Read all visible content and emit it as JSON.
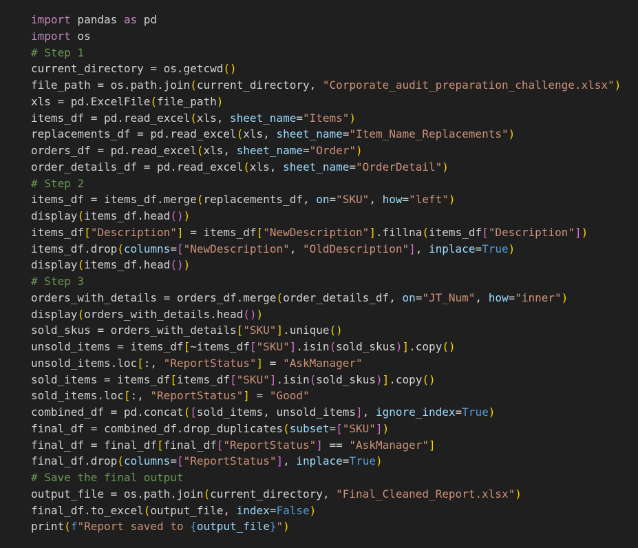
{
  "colors": {
    "background": "#1f1f1f",
    "default_text": "#d4d4d4",
    "keyword": "#c586c0",
    "comment": "#6a9955",
    "string": "#ce9178",
    "param": "#9cdcfe",
    "constant": "#569cd6",
    "bracket_level_1": "#ffd700",
    "bracket_level_2": "#da70d6",
    "bracket_level_3": "#179fff"
  },
  "code": {
    "language": "python",
    "lines": [
      [
        [
          "keyword",
          "import"
        ],
        [
          "name",
          " pandas "
        ],
        [
          "keyword",
          "as"
        ],
        [
          "name",
          " pd"
        ]
      ],
      [
        [
          "keyword",
          "import"
        ],
        [
          "name",
          " os"
        ]
      ],
      [
        [
          "comment",
          "# Step 1"
        ]
      ],
      [
        [
          "name",
          "current_directory = os.getcwd"
        ],
        [
          "paren1",
          "()"
        ]
      ],
      [
        [
          "name",
          "file_path = os.path.join"
        ],
        [
          "paren1",
          "("
        ],
        [
          "name",
          "current_directory, "
        ],
        [
          "string",
          "\"Corporate_audit_preparation_challenge.xlsx\""
        ],
        [
          "paren1",
          ")"
        ]
      ],
      [
        [
          "name",
          "xls = pd.ExcelFile"
        ],
        [
          "paren1",
          "("
        ],
        [
          "name",
          "file_path"
        ],
        [
          "paren1",
          ")"
        ]
      ],
      [
        [
          "name",
          "items_df = pd.read_excel"
        ],
        [
          "paren1",
          "("
        ],
        [
          "name",
          "xls, "
        ],
        [
          "param",
          "sheet_name"
        ],
        [
          "name",
          "="
        ],
        [
          "string",
          "\"Items\""
        ],
        [
          "paren1",
          ")"
        ]
      ],
      [
        [
          "name",
          "replacements_df = pd.read_excel"
        ],
        [
          "paren1",
          "("
        ],
        [
          "name",
          "xls, "
        ],
        [
          "param",
          "sheet_name"
        ],
        [
          "name",
          "="
        ],
        [
          "string",
          "\"Item_Name_Replacements\""
        ],
        [
          "paren1",
          ")"
        ]
      ],
      [
        [
          "name",
          "orders_df = pd.read_excel"
        ],
        [
          "paren1",
          "("
        ],
        [
          "name",
          "xls, "
        ],
        [
          "param",
          "sheet_name"
        ],
        [
          "name",
          "="
        ],
        [
          "string",
          "\"Order\""
        ],
        [
          "paren1",
          ")"
        ]
      ],
      [
        [
          "name",
          "order_details_df = pd.read_excel"
        ],
        [
          "paren1",
          "("
        ],
        [
          "name",
          "xls, "
        ],
        [
          "param",
          "sheet_name"
        ],
        [
          "name",
          "="
        ],
        [
          "string",
          "\"OrderDetail\""
        ],
        [
          "paren1",
          ")"
        ]
      ],
      [
        [
          "comment",
          "# Step 2"
        ]
      ],
      [
        [
          "name",
          "items_df = items_df.merge"
        ],
        [
          "paren1",
          "("
        ],
        [
          "name",
          "replacements_df, "
        ],
        [
          "param",
          "on"
        ],
        [
          "name",
          "="
        ],
        [
          "string",
          "\"SKU\""
        ],
        [
          "name",
          ", "
        ],
        [
          "param",
          "how"
        ],
        [
          "name",
          "="
        ],
        [
          "string",
          "\"left\""
        ],
        [
          "paren1",
          ")"
        ]
      ],
      [
        [
          "name",
          "display"
        ],
        [
          "paren1",
          "("
        ],
        [
          "name",
          "items_df.head"
        ],
        [
          "paren2",
          "()"
        ],
        [
          "paren1",
          ")"
        ]
      ],
      [
        [
          "name",
          "items_df"
        ],
        [
          "paren1",
          "["
        ],
        [
          "string",
          "\"Description\""
        ],
        [
          "paren1",
          "]"
        ],
        [
          "name",
          " = items_df"
        ],
        [
          "paren1",
          "["
        ],
        [
          "string",
          "\"NewDescription\""
        ],
        [
          "paren1",
          "]"
        ],
        [
          "name",
          ".fillna"
        ],
        [
          "paren1",
          "("
        ],
        [
          "name",
          "items_df"
        ],
        [
          "paren2",
          "["
        ],
        [
          "string",
          "\"Description\""
        ],
        [
          "paren2",
          "]"
        ],
        [
          "paren1",
          ")"
        ]
      ],
      [
        [
          "name",
          "items_df.drop"
        ],
        [
          "paren1",
          "("
        ],
        [
          "param",
          "columns"
        ],
        [
          "name",
          "="
        ],
        [
          "paren2",
          "["
        ],
        [
          "string",
          "\"NewDescription\""
        ],
        [
          "name",
          ", "
        ],
        [
          "string",
          "\"OldDescription\""
        ],
        [
          "paren2",
          "]"
        ],
        [
          "name",
          ", "
        ],
        [
          "param",
          "inplace"
        ],
        [
          "name",
          "="
        ],
        [
          "const",
          "True"
        ],
        [
          "paren1",
          ")"
        ]
      ],
      [
        [
          "name",
          "display"
        ],
        [
          "paren1",
          "("
        ],
        [
          "name",
          "items_df.head"
        ],
        [
          "paren2",
          "()"
        ],
        [
          "paren1",
          ")"
        ]
      ],
      [
        [
          "comment",
          "# Step 3"
        ]
      ],
      [
        [
          "name",
          "orders_with_details = orders_df.merge"
        ],
        [
          "paren1",
          "("
        ],
        [
          "name",
          "order_details_df, "
        ],
        [
          "param",
          "on"
        ],
        [
          "name",
          "="
        ],
        [
          "string",
          "\"JT_Num\""
        ],
        [
          "name",
          ", "
        ],
        [
          "param",
          "how"
        ],
        [
          "name",
          "="
        ],
        [
          "string",
          "\"inner\""
        ],
        [
          "paren1",
          ")"
        ]
      ],
      [
        [
          "name",
          "display"
        ],
        [
          "paren1",
          "("
        ],
        [
          "name",
          "orders_with_details.head"
        ],
        [
          "paren2",
          "()"
        ],
        [
          "paren1",
          ")"
        ]
      ],
      [
        [
          "name",
          "sold_skus = orders_with_details"
        ],
        [
          "paren1",
          "["
        ],
        [
          "string",
          "\"SKU\""
        ],
        [
          "paren1",
          "]"
        ],
        [
          "name",
          ".unique"
        ],
        [
          "paren1",
          "()"
        ]
      ],
      [
        [
          "name",
          "unsold_items = items_df"
        ],
        [
          "paren1",
          "["
        ],
        [
          "name",
          "~items_df"
        ],
        [
          "paren2",
          "["
        ],
        [
          "string",
          "\"SKU\""
        ],
        [
          "paren2",
          "]"
        ],
        [
          "name",
          ".isin"
        ],
        [
          "paren2",
          "("
        ],
        [
          "name",
          "sold_skus"
        ],
        [
          "paren2",
          ")"
        ],
        [
          "paren1",
          "]"
        ],
        [
          "name",
          ".copy"
        ],
        [
          "paren1",
          "()"
        ]
      ],
      [
        [
          "name",
          "unsold_items.loc"
        ],
        [
          "paren1",
          "["
        ],
        [
          "name",
          ":, "
        ],
        [
          "string",
          "\"ReportStatus\""
        ],
        [
          "paren1",
          "]"
        ],
        [
          "name",
          " = "
        ],
        [
          "string",
          "\"AskManager\""
        ]
      ],
      [
        [
          "name",
          "sold_items = items_df"
        ],
        [
          "paren1",
          "["
        ],
        [
          "name",
          "items_df"
        ],
        [
          "paren2",
          "["
        ],
        [
          "string",
          "\"SKU\""
        ],
        [
          "paren2",
          "]"
        ],
        [
          "name",
          ".isin"
        ],
        [
          "paren2",
          "("
        ],
        [
          "name",
          "sold_skus"
        ],
        [
          "paren2",
          ")"
        ],
        [
          "paren1",
          "]"
        ],
        [
          "name",
          ".copy"
        ],
        [
          "paren1",
          "()"
        ]
      ],
      [
        [
          "name",
          "sold_items.loc"
        ],
        [
          "paren1",
          "["
        ],
        [
          "name",
          ":, "
        ],
        [
          "string",
          "\"ReportStatus\""
        ],
        [
          "paren1",
          "]"
        ],
        [
          "name",
          " = "
        ],
        [
          "string",
          "\"Good\""
        ]
      ],
      [
        [
          "name",
          "combined_df = pd.concat"
        ],
        [
          "paren1",
          "("
        ],
        [
          "paren2",
          "["
        ],
        [
          "name",
          "sold_items, unsold_items"
        ],
        [
          "paren2",
          "]"
        ],
        [
          "name",
          ", "
        ],
        [
          "param",
          "ignore_index"
        ],
        [
          "name",
          "="
        ],
        [
          "const",
          "True"
        ],
        [
          "paren1",
          ")"
        ]
      ],
      [
        [
          "name",
          "final_df = combined_df.drop_duplicates"
        ],
        [
          "paren1",
          "("
        ],
        [
          "param",
          "subset"
        ],
        [
          "name",
          "="
        ],
        [
          "paren2",
          "["
        ],
        [
          "string",
          "\"SKU\""
        ],
        [
          "paren2",
          "]"
        ],
        [
          "paren1",
          ")"
        ]
      ],
      [
        [
          "name",
          "final_df = final_df"
        ],
        [
          "paren1",
          "["
        ],
        [
          "name",
          "final_df"
        ],
        [
          "paren2",
          "["
        ],
        [
          "string",
          "\"ReportStatus\""
        ],
        [
          "paren2",
          "]"
        ],
        [
          "name",
          " == "
        ],
        [
          "string",
          "\"AskManager\""
        ],
        [
          "paren1",
          "]"
        ]
      ],
      [
        [
          "name",
          "final_df.drop"
        ],
        [
          "paren1",
          "("
        ],
        [
          "param",
          "columns"
        ],
        [
          "name",
          "="
        ],
        [
          "paren2",
          "["
        ],
        [
          "string",
          "\"ReportStatus\""
        ],
        [
          "paren2",
          "]"
        ],
        [
          "name",
          ", "
        ],
        [
          "param",
          "inplace"
        ],
        [
          "name",
          "="
        ],
        [
          "const",
          "True"
        ],
        [
          "paren1",
          ")"
        ]
      ],
      [
        [
          "comment",
          "# Save the final output"
        ]
      ],
      [
        [
          "name",
          "output_file = os.path.join"
        ],
        [
          "paren1",
          "("
        ],
        [
          "name",
          "current_directory, "
        ],
        [
          "string",
          "\"Final_Cleaned_Report.xlsx\""
        ],
        [
          "paren1",
          ")"
        ]
      ],
      [
        [
          "name",
          "final_df.to_excel"
        ],
        [
          "paren1",
          "("
        ],
        [
          "name",
          "output_file, "
        ],
        [
          "param",
          "index"
        ],
        [
          "name",
          "="
        ],
        [
          "const",
          "False"
        ],
        [
          "paren1",
          ")"
        ]
      ],
      [
        [
          "name",
          "print"
        ],
        [
          "paren1",
          "("
        ],
        [
          "fstring",
          "f"
        ],
        [
          "string",
          "\"Report saved to "
        ],
        [
          "fstring",
          "{"
        ],
        [
          "interp",
          "output_file"
        ],
        [
          "fstring",
          "}"
        ],
        [
          "string",
          "\""
        ],
        [
          "paren1",
          ")"
        ]
      ]
    ]
  }
}
